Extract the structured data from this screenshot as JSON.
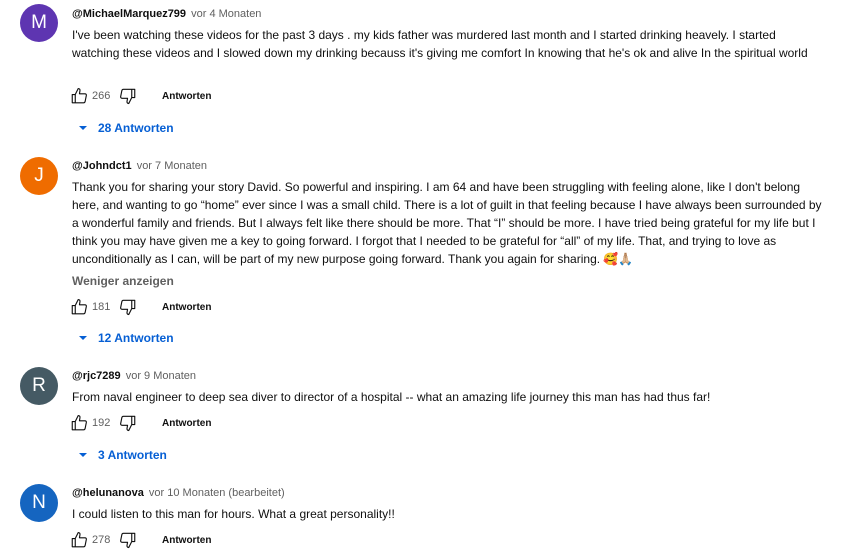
{
  "comments": [
    {
      "avatar_letter": "M",
      "avatar_color": "#5e35b1",
      "author": "@MichaelMarquez799",
      "time": "vor 4 Monaten",
      "text": "I've been watching these videos for the past 3 days . my kids father was murdered last month and I started drinking heavely. I started watching these videos and I slowed down my drinking becauss it's giving me comfort In knowing that he's ok and alive In the spiritual world",
      "likes": "266",
      "reply_label": "Antworten",
      "replies_label": "28 Antworten"
    },
    {
      "avatar_letter": "J",
      "avatar_color": "#ef6c00",
      "author": "@Johndct1",
      "time": "vor 7 Monaten",
      "text": "Thank you for sharing your story David.  So powerful and inspiring.  I am 64 and have been struggling with feeling alone, like I don't belong here, and wanting to go “home” ever since I was a small child.  There is a lot of guilt in that feeling because I have always been surrounded by a wonderful family and friends.  But I always felt like there should be more.  That “I” should be more.  I have tried being grateful for my life but I think you may have given me a key to going forward.  I forgot that I needed to be grateful for “all” of my life.  That, and trying to love as unconditionally as I can, will be part of my new purpose going forward.  Thank you again for sharing. 🥰🙏🏼",
      "show_less": "Weniger anzeigen",
      "likes": "181",
      "reply_label": "Antworten",
      "replies_label": "12 Antworten"
    },
    {
      "avatar_letter": "R",
      "avatar_color": "#455a64",
      "author": "@rjc7289",
      "time": "vor 9 Monaten",
      "text": "From naval engineer to deep sea diver to director of a hospital -- what an amazing life journey this man has had thus far!",
      "likes": "192",
      "reply_label": "Antworten",
      "replies_label": "3 Antworten"
    },
    {
      "avatar_letter": "N",
      "avatar_color": "#1565c0",
      "author": "@helunanova",
      "time": "vor 10 Monaten (bearbeitet)",
      "text": "I could listen to this man for hours. What a great personality!!",
      "likes": "278",
      "reply_label": "Antworten"
    }
  ]
}
